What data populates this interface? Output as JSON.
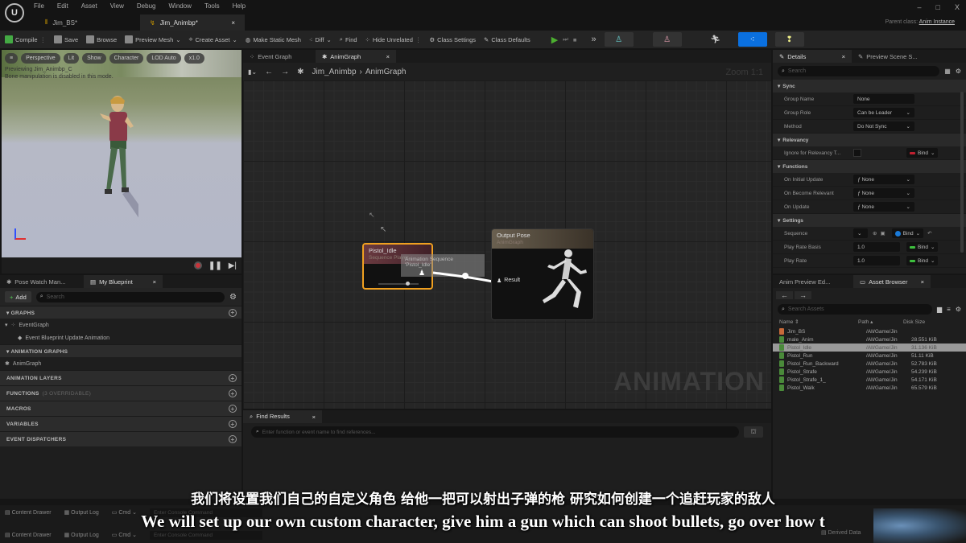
{
  "app": {
    "logo": "U",
    "menu": [
      "File",
      "Edit",
      "Asset",
      "View",
      "Debug",
      "Window",
      "Tools",
      "Help"
    ],
    "doc_tabs": [
      {
        "label": "Jim_BS*",
        "active": false
      },
      {
        "label": "Jim_Animbp*",
        "active": true
      }
    ],
    "window_controls": [
      "–",
      "□",
      "X"
    ],
    "parent_class_label": "Parent class:",
    "parent_class_value": "Anim Instance"
  },
  "toolbar": {
    "items": [
      "Compile",
      "Save",
      "Browse",
      "Preview Mesh",
      "Create Asset",
      "Make Static Mesh",
      "Diff",
      "Find",
      "Hide Unrelated",
      "Class Settings",
      "Class Defaults"
    ],
    "play_icons": [
      "▶",
      "⏭",
      "■"
    ],
    "overflow": "»"
  },
  "viewport": {
    "pills": [
      "Perspective",
      "Lit",
      "Show",
      "Character",
      "LOD Auto",
      "x1.0"
    ],
    "info_line1": "Previewing Jim_Animbp_C",
    "info_line2": "Bone manipulation is disabled in this mode."
  },
  "left_panel": {
    "tabs": [
      "Pose Watch Man...",
      "My Blueprint"
    ],
    "add_label": "Add",
    "search_placeholder": "Search",
    "sections": {
      "graphs": "GRAPHS",
      "event_graph": "EventGraph",
      "event_update": "Event Blueprint Update Animation",
      "anim_graphs": "ANIMATION GRAPHS",
      "anim_graph": "AnimGraph",
      "anim_layers": "ANIMATION LAYERS",
      "functions": "FUNCTIONS",
      "functions_hint": "(3 OVERRIDABLE)",
      "macros": "MACROS",
      "variables": "VARIABLES",
      "event_dispatchers": "EVENT DISPATCHERS"
    }
  },
  "graph": {
    "tabs": [
      "Event Graph",
      "AnimGraph"
    ],
    "breadcrumb": [
      "Jim_Animbp",
      "AnimGraph"
    ],
    "breadcrumb_sep": "›",
    "zoom_label": "Zoom 1:1",
    "watermark": "ANIMATION",
    "node_pistol": {
      "title": "Pistol_Idle",
      "subtitle": "Sequence Player"
    },
    "node_output": {
      "title": "Output Pose",
      "subtitle": "AnimGraph",
      "pin": "Result"
    },
    "tooltip_line1": "Animation Sequence 'Pistol_Idle'"
  },
  "find_results": {
    "tab": "Find Results",
    "placeholder": "Enter function or event name to find references..."
  },
  "details": {
    "tabs": [
      "Details",
      "Preview Scene S..."
    ],
    "search_placeholder": "Search",
    "sync": {
      "title": "Sync",
      "rows": [
        {
          "label": "Group Name",
          "value": "None"
        },
        {
          "label": "Group Role",
          "value": "Can be Leader"
        },
        {
          "label": "Method",
          "value": "Do Not Sync"
        }
      ]
    },
    "relevancy": {
      "title": "Relevancy",
      "label": "Ignore for Relevancy T...",
      "bind": "Bind"
    },
    "functions": {
      "title": "Functions",
      "rows": [
        {
          "label": "On Initial Update",
          "value": "None"
        },
        {
          "label": "On Become Relevant",
          "value": "None"
        },
        {
          "label": "On Update",
          "value": "None"
        }
      ]
    },
    "settings": {
      "title": "Settings",
      "rows": [
        {
          "label": "Sequence",
          "value": "",
          "bind": "Bind"
        },
        {
          "label": "Play Rate Basis",
          "value": "1.0",
          "bind": "Bind"
        },
        {
          "label": "Play Rate",
          "value": "1.0",
          "bind": "Bind"
        }
      ]
    },
    "colors": {
      "bind_red": "#c02030",
      "bind_green": "#3ec03e",
      "bind_blue": "#1a7ad8"
    }
  },
  "asset_browser": {
    "tabs": [
      "Anim Preview Ed...",
      "Asset Browser"
    ],
    "search_placeholder": "Search Assets",
    "columns": [
      "Name",
      "Path",
      "Disk Size"
    ],
    "rows": [
      {
        "name": "Jim_BS",
        "path": "/All/Game/Jin",
        "size": ""
      },
      {
        "name": "male_Anim",
        "path": "/All/Game/Jin",
        "size": "28.551 KiB"
      },
      {
        "name": "Pistol_Idle",
        "path": "/All/Game/Jin",
        "size": "31.136 KiB",
        "selected": true
      },
      {
        "name": "Pistol_Run",
        "path": "/All/Game/Jin",
        "size": "51.11 KiB"
      },
      {
        "name": "Pistol_Run_Backward",
        "path": "/All/Game/Jin",
        "size": "52.783 KiB"
      },
      {
        "name": "Pistol_Strafe",
        "path": "/All/Game/Jin",
        "size": "54.239 KiB"
      },
      {
        "name": "Pistol_Strafe_1_",
        "path": "/All/Game/Jin",
        "size": "54.171 KiB"
      },
      {
        "name": "Pistol_Walk",
        "path": "/All/Game/Jin",
        "size": "65.579 KiB"
      }
    ]
  },
  "status_bar": {
    "content_drawer": "Content Drawer",
    "output_log": "Output Log",
    "cmd": "Cmd",
    "console_placeholder": "Enter Console Command",
    "derived_data": "Derived Data"
  },
  "subtitles": {
    "cn": "我们将设置我们自己的自定义角色 给他一把可以射出子弹的枪 研究如何创建一个追赶玩家的敌人",
    "en": "We will set up our own custom character, give him a gun which can shoot bullets, go over how t"
  }
}
